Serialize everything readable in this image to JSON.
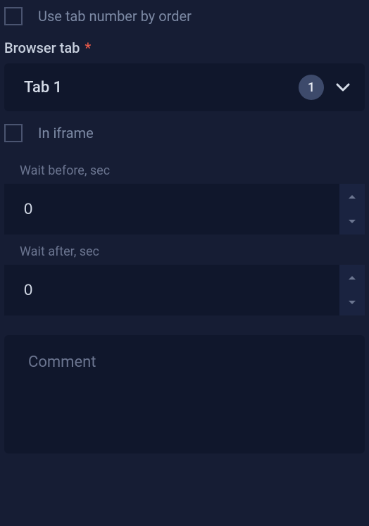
{
  "checkbox_use_tab_order": {
    "label": "Use tab number by order",
    "checked": false
  },
  "browser_tab": {
    "label": "Browser tab",
    "required_marker": "*",
    "selected_text": "Tab 1",
    "badge_count": "1"
  },
  "checkbox_in_iframe": {
    "label": "In iframe",
    "checked": false
  },
  "wait_before": {
    "label": "Wait before, sec",
    "value": "0"
  },
  "wait_after": {
    "label": "Wait after, sec",
    "value": "0"
  },
  "comment": {
    "placeholder": "Comment",
    "value": ""
  }
}
